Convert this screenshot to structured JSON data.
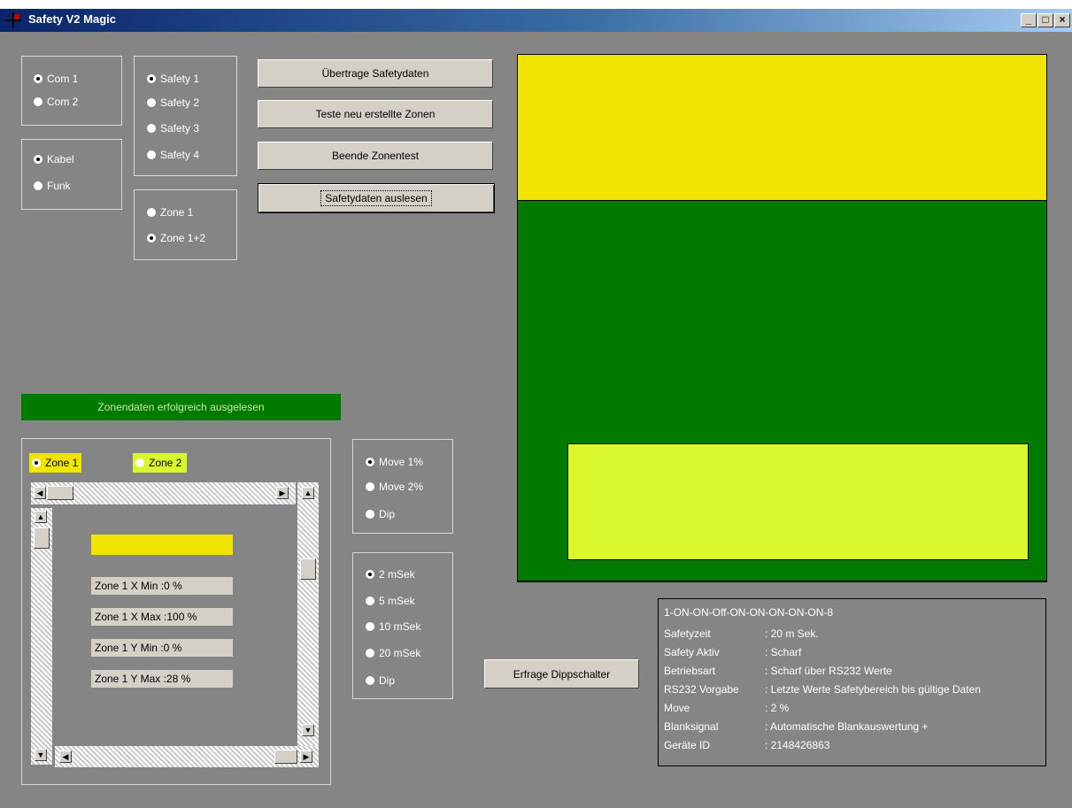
{
  "window": {
    "title": "Safety V2 Magic",
    "minimize": "_",
    "maximize": "□",
    "close": "×"
  },
  "com": [
    {
      "label": "Com 1",
      "checked": true
    },
    {
      "label": "Com 2",
      "checked": false
    }
  ],
  "safety": [
    {
      "label": "Safety 1",
      "checked": true
    },
    {
      "label": "Safety 2",
      "checked": false
    },
    {
      "label": "Safety 3",
      "checked": false
    },
    {
      "label": "Safety 4",
      "checked": false
    }
  ],
  "connection": [
    {
      "label": "Kabel",
      "checked": true
    },
    {
      "label": "Funk",
      "checked": false
    }
  ],
  "zone_select": [
    {
      "label": "Zone 1",
      "checked": false
    },
    {
      "label": "Zone 1+2",
      "checked": true
    }
  ],
  "buttons": {
    "transfer": "Übertrage Safetydaten",
    "test": "Teste neu erstellte Zonen",
    "end_test": "Beende Zonentest",
    "read": "Safetydaten auslesen",
    "dip": "Erfrage Dippschalter"
  },
  "status_message": "Zonendaten erfolgreich ausgelesen",
  "zone_tabs": [
    {
      "label": "Zone 1",
      "checked": true
    },
    {
      "label": "Zone 2",
      "checked": false
    }
  ],
  "zone_values": {
    "xmin": "Zone 1 X Min :0 %",
    "xmax": "Zone 1 X Max :100 %",
    "ymin": "Zone 1 Y Min :0 %",
    "ymax": "Zone 1 Y Max :28 %"
  },
  "move": [
    {
      "label": "Move 1%",
      "checked": true
    },
    {
      "label": "Move 2%",
      "checked": false
    },
    {
      "label": "Dip",
      "checked": false
    }
  ],
  "time": [
    {
      "label": "2 mSek",
      "checked": true
    },
    {
      "label": "5 mSek",
      "checked": false
    },
    {
      "label": "10 mSek",
      "checked": false
    },
    {
      "label": "20 mSek",
      "checked": false
    },
    {
      "label": "Dip",
      "checked": false
    }
  ],
  "info": {
    "header": "1-ON-ON-Off-ON-ON-ON-ON-ON-8",
    "rows": [
      {
        "key": "Safetyzeit",
        "value": ": 20 m Sek."
      },
      {
        "key": "Safety Aktiv",
        "value": ": Scharf"
      },
      {
        "key": "Betriebsart",
        "value": ": Scharf über RS232 Werte"
      },
      {
        "key": "RS232 Vorgabe",
        "value": ": Letzte Werte Safetybereich bis gültige Daten"
      },
      {
        "key": "Move",
        "value": ": 2 %"
      },
      {
        "key": "Blanksignal",
        "value": ": Automatische Blankauswertung +"
      },
      {
        "key": "Geräte ID",
        "value": ": 2148426863"
      }
    ]
  },
  "colors": {
    "zone_yellow": "#f0e400",
    "zone_green": "#007b00",
    "zone_lime": "#d9f72a",
    "background": "#858585"
  }
}
